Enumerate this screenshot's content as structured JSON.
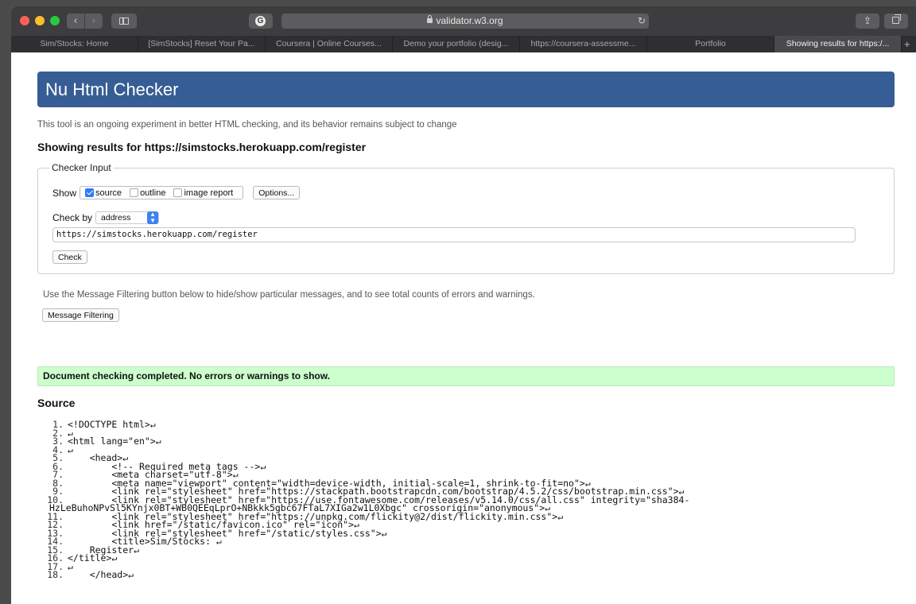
{
  "browser": {
    "url": "validator.w3.org",
    "tabs": [
      {
        "label": "Sim/Stocks: Home",
        "active": false
      },
      {
        "label": "[SimStocks] Reset Your Pa...",
        "active": false
      },
      {
        "label": "Coursera | Online Courses...",
        "active": false
      },
      {
        "label": "Demo your portfolio (desig...",
        "active": false
      },
      {
        "label": "https://coursera-assessme...",
        "active": false
      },
      {
        "label": "Portfolio",
        "active": false
      },
      {
        "label": "Showing results for https:/...",
        "active": true
      }
    ],
    "new_tab_label": "+"
  },
  "page": {
    "title": "Nu Html Checker",
    "intro": "This tool is an ongoing experiment in better HTML checking, and its behavior remains subject to change",
    "results_heading": "Showing results for https://simstocks.herokuapp.com/register",
    "checker": {
      "legend": "Checker Input",
      "show_label": "Show",
      "show_options": [
        {
          "label": "source",
          "checked": true
        },
        {
          "label": "outline",
          "checked": false
        },
        {
          "label": "image report",
          "checked": false
        }
      ],
      "options_button": "Options...",
      "check_by_label": "Check by",
      "check_by_value": "address",
      "address": "https://simstocks.herokuapp.com/register",
      "check_button": "Check"
    },
    "filter_note": "Use the Message Filtering button below to hide/show particular messages, and to see total counts of errors and warnings.",
    "filter_button": "Message Filtering",
    "success_message": "Document checking completed. No errors or warnings to show.",
    "source_heading": "Source",
    "source_lines": [
      {
        "n": "1.",
        "text": "<!DOCTYPE html>↵"
      },
      {
        "n": "2.",
        "text": "↵"
      },
      {
        "n": "3.",
        "text": "<html lang=\"en\">↵"
      },
      {
        "n": "4.",
        "text": "↵"
      },
      {
        "n": "5.",
        "text": "    <head>↵"
      },
      {
        "n": "6.",
        "text": "        <!-- Required meta tags -->↵"
      },
      {
        "n": "7.",
        "text": "        <meta charset=\"utf-8\">↵"
      },
      {
        "n": "8.",
        "text": "        <meta name=\"viewport\" content=\"width=device-width, initial-scale=1, shrink-to-fit=no\">↵"
      },
      {
        "n": "9.",
        "text": "        <link rel=\"stylesheet\" href=\"https://stackpath.bootstrapcdn.com/bootstrap/4.5.2/css/bootstrap.min.css\">↵"
      },
      {
        "n": "10.",
        "text": "        <link rel=\"stylesheet\" href=\"https://use.fontawesome.com/releases/v5.14.0/css/all.css\" integrity=\"sha384-"
      },
      {
        "n": "",
        "text": "HzLeBuhoNPvSl5KYnjx0BT+WB0QEEqLprO+NBkkk5gbc67FTaL7XIGa2w1L0Xbgc\" crossorigin=\"anonymous\">↵"
      },
      {
        "n": "11.",
        "text": "        <link rel=\"stylesheet\" href=\"https://unpkg.com/flickity@2/dist/flickity.min.css\">↵"
      },
      {
        "n": "12.",
        "text": "        <link href=\"/static/favicon.ico\" rel=\"icon\">↵"
      },
      {
        "n": "13.",
        "text": "        <link rel=\"stylesheet\" href=\"/static/styles.css\">↵"
      },
      {
        "n": "14.",
        "text": "        <title>Sim/Stocks: ↵"
      },
      {
        "n": "15.",
        "text": "    Register↵"
      },
      {
        "n": "16.",
        "text": "</title>↵"
      },
      {
        "n": "17.",
        "text": "↵"
      },
      {
        "n": "18.",
        "text": "    </head>↵"
      }
    ]
  },
  "colors": {
    "hero_bg": "#365d95",
    "success_bg": "#ccffcc",
    "checkbox_on": "#2f7bf5"
  }
}
